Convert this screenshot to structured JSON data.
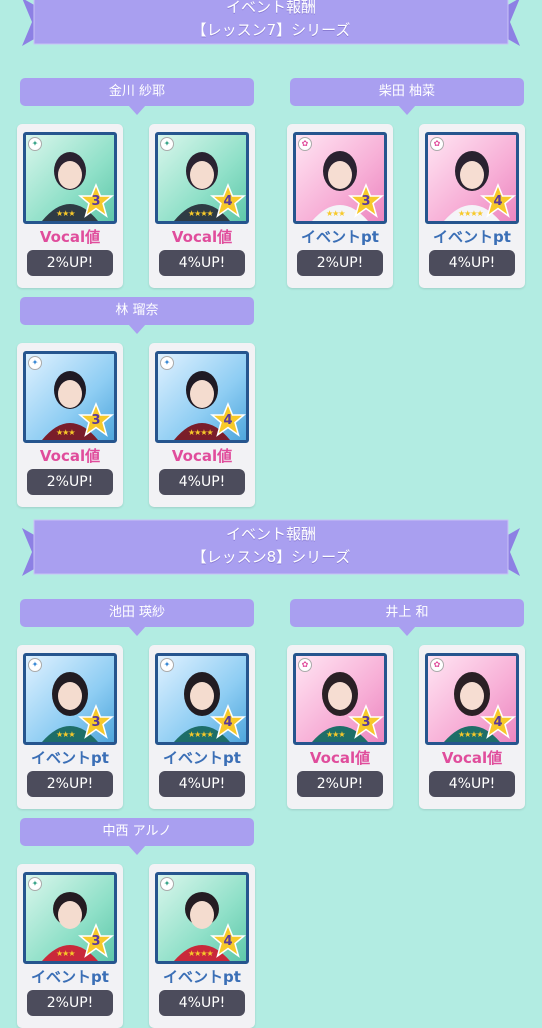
{
  "sections": [
    {
      "title_line1": "イベント報酬",
      "title_line2": "【レッスン7】シリーズ",
      "members": [
        {
          "name": "金川 紗耶",
          "cards": [
            {
              "rank": "3",
              "boost": "Vocal値",
              "percent": "2%UP!",
              "frame": "green"
            },
            {
              "rank": "4",
              "boost": "Vocal値",
              "percent": "4%UP!",
              "frame": "green"
            }
          ]
        },
        {
          "name": "柴田 柚菜",
          "cards": [
            {
              "rank": "3",
              "boost": "イベントpt",
              "percent": "2%UP!",
              "frame": "pink"
            },
            {
              "rank": "4",
              "boost": "イベントpt",
              "percent": "4%UP!",
              "frame": "pink"
            }
          ]
        },
        {
          "name": "林 瑠奈",
          "cards": [
            {
              "rank": "3",
              "boost": "Vocal値",
              "percent": "2%UP!",
              "frame": "blue"
            },
            {
              "rank": "4",
              "boost": "Vocal値",
              "percent": "4%UP!",
              "frame": "blue"
            }
          ]
        }
      ]
    },
    {
      "title_line1": "イベント報酬",
      "title_line2": "【レッスン8】シリーズ",
      "members": [
        {
          "name": "池田 瑛紗",
          "cards": [
            {
              "rank": "3",
              "boost": "イベントpt",
              "percent": "2%UP!",
              "frame": "blue"
            },
            {
              "rank": "4",
              "boost": "イベントpt",
              "percent": "4%UP!",
              "frame": "blue"
            }
          ]
        },
        {
          "name": "井上 和",
          "cards": [
            {
              "rank": "3",
              "boost": "Vocal値",
              "percent": "2%UP!",
              "frame": "pink"
            },
            {
              "rank": "4",
              "boost": "Vocal値",
              "percent": "4%UP!",
              "frame": "pink"
            }
          ]
        },
        {
          "name": "中西 アルノ",
          "cards": [
            {
              "rank": "3",
              "boost": "イベントpt",
              "percent": "2%UP!",
              "frame": "green"
            },
            {
              "rank": "4",
              "boost": "イベントpt",
              "percent": "4%UP!",
              "frame": "green"
            }
          ]
        }
      ]
    }
  ],
  "icons": {
    "attribute": "attribute-badge-icon",
    "rank": "rank-star-icon"
  },
  "colors": {
    "background": "#b2ece2",
    "banner": "#a99ff0",
    "vocal_text": "#e04d9c",
    "event_text": "#3b6fb6",
    "pill": "#4c4c5c"
  }
}
